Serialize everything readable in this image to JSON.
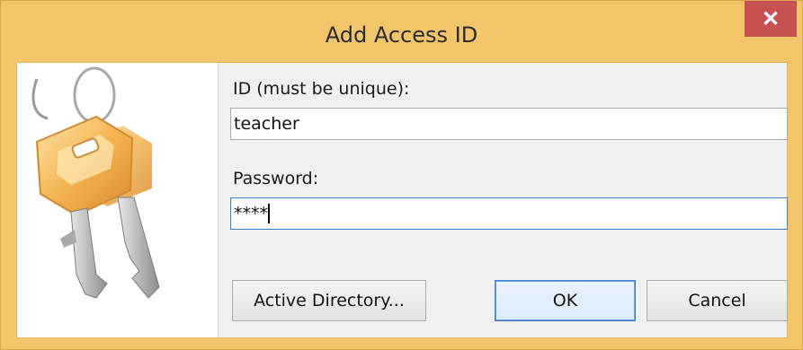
{
  "window": {
    "title": "Add Access ID",
    "close_glyph": "✕"
  },
  "form": {
    "id_label": "ID (must be unique):",
    "id_value": "teacher",
    "password_label": "Password:",
    "password_value": "****"
  },
  "buttons": {
    "active_directory": "Active Directory...",
    "ok": "OK",
    "cancel": "Cancel"
  },
  "icons": {
    "keys": "keys-icon"
  },
  "colors": {
    "title_bar": "#f3c56a",
    "close": "#c75050",
    "focus": "#3c7fd0"
  }
}
